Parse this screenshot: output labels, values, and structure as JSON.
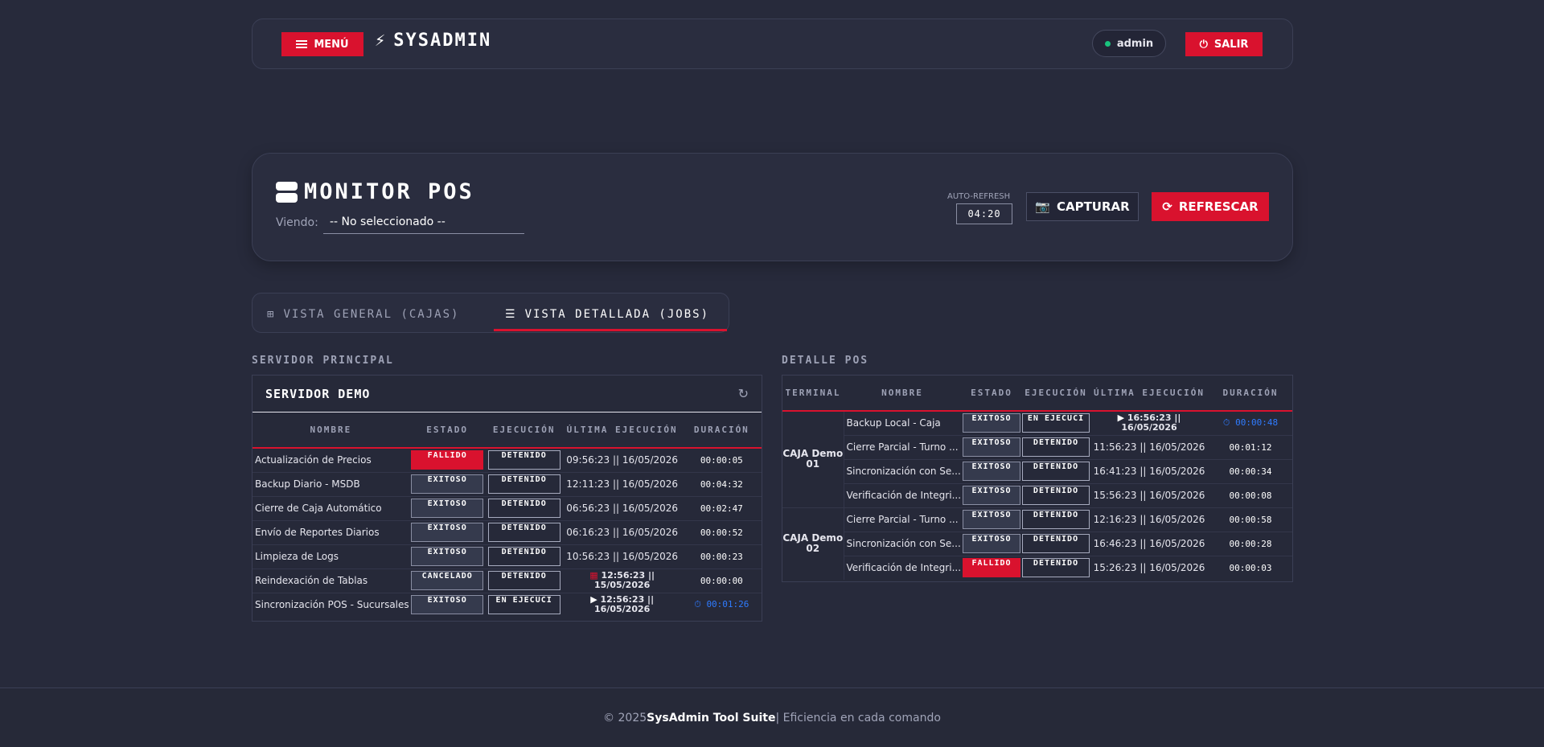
{
  "header": {
    "menu_label": "MENÚ",
    "brand": "SYSADMIN",
    "user": "admin",
    "logout_label": "SALIR",
    "colors": {
      "accent": "#d9122e",
      "online": "#19c37d"
    }
  },
  "monitor": {
    "title": "MONITOR POS",
    "viendo_label": "Viendo:",
    "viendo_value": "-- No seleccionado --",
    "auto_refresh_label": "AUTO-REFRESH",
    "auto_refresh_value": "04:20",
    "capture_label": "CAPTURAR",
    "refresh_label": "REFRESCAR"
  },
  "tabs": [
    {
      "label": "VISTA GENERAL (CAJAS)",
      "icon": "grid-icon",
      "active": false
    },
    {
      "label": "VISTA DETALLADA (JOBS)",
      "icon": "list-check-icon",
      "active": true
    }
  ],
  "servidor": {
    "section_title": "SERVIDOR PRINCIPAL",
    "card_title": "SERVIDOR DEMO",
    "columns": [
      "NOMBRE",
      "ESTADO",
      "EJECUCIÓN",
      "ÚLTIMA EJECUCIÓN",
      "DURACIÓN"
    ],
    "rows": [
      {
        "nombre": "Actualización de Precios",
        "estado": "FALLIDO",
        "ejecucion": "DETENIDO",
        "ultima": "09:56:23 || 16/05/2026",
        "duracion": "00:00:05"
      },
      {
        "nombre": "Backup Diario - MSDB",
        "estado": "EXITOSO",
        "ejecucion": "DETENIDO",
        "ultima": "12:11:23 || 16/05/2026",
        "duracion": "00:04:32"
      },
      {
        "nombre": "Cierre de Caja Automático",
        "estado": "EXITOSO",
        "ejecucion": "DETENIDO",
        "ultima": "06:56:23 || 16/05/2026",
        "duracion": "00:02:47"
      },
      {
        "nombre": "Envío de Reportes Diarios",
        "estado": "EXITOSO",
        "ejecucion": "DETENIDO",
        "ultima": "06:16:23 || 16/05/2026",
        "duracion": "00:00:52"
      },
      {
        "nombre": "Limpieza de Logs",
        "estado": "EXITOSO",
        "ejecucion": "DETENIDO",
        "ultima": "10:56:23 || 16/05/2026",
        "duracion": "00:00:23"
      },
      {
        "nombre": "Reindexación de Tablas",
        "estado": "CANCELADO",
        "ejecucion": "DETENIDO",
        "ultima": "12:56:23 || 15/05/2026",
        "duracion": "00:00:00",
        "icon": "calendar-icon"
      },
      {
        "nombre": "Sincronización POS - Sucursales",
        "estado": "EXITOSO",
        "ejecucion": "EN EJECUCI",
        "ultima": "12:56:23 || 16/05/2026",
        "duracion": "00:01:26",
        "icon": "play-icon",
        "running": true
      }
    ]
  },
  "detalle": {
    "section_title": "DETALLE POS",
    "columns": [
      "TERMINAL",
      "NOMBRE",
      "ESTADO",
      "EJECUCIÓN",
      "ÚLTIMA EJECUCIÓN",
      "DURACIÓN"
    ],
    "groups": [
      {
        "terminal": "CAJA Demo 01",
        "rows": [
          {
            "nombre": "Backup Local - Caja",
            "estado": "EXITOSO",
            "ejecucion": "EN EJECUCI",
            "ultima": "16:56:23 || 16/05/2026",
            "duracion": "00:00:48",
            "icon": "play-icon",
            "running": true
          },
          {
            "nombre": "Cierre Parcial - Turno ...",
            "estado": "EXITOSO",
            "ejecucion": "DETENIDO",
            "ultima": "11:56:23 || 16/05/2026",
            "duracion": "00:01:12"
          },
          {
            "nombre": "Sincronización con Se...",
            "estado": "EXITOSO",
            "ejecucion": "DETENIDO",
            "ultima": "16:41:23 || 16/05/2026",
            "duracion": "00:00:34"
          },
          {
            "nombre": "Verificación de Integri...",
            "estado": "EXITOSO",
            "ejecucion": "DETENIDO",
            "ultima": "15:56:23 || 16/05/2026",
            "duracion": "00:00:08"
          }
        ]
      },
      {
        "terminal": "CAJA Demo 02",
        "rows": [
          {
            "nombre": "Cierre Parcial - Turno ...",
            "estado": "EXITOSO",
            "ejecucion": "DETENIDO",
            "ultima": "12:16:23 || 16/05/2026",
            "duracion": "00:00:58"
          },
          {
            "nombre": "Sincronización con Se...",
            "estado": "EXITOSO",
            "ejecucion": "DETENIDO",
            "ultima": "16:46:23 || 16/05/2026",
            "duracion": "00:00:28"
          },
          {
            "nombre": "Verificación de Integri...",
            "estado": "FALLIDO",
            "ejecucion": "DETENIDO",
            "ultima": "15:26:23 || 16/05/2026",
            "duracion": "00:00:03"
          }
        ]
      }
    ]
  },
  "footer": {
    "copy": "© 2025 ",
    "brand": "SysAdmin Tool Suite",
    "tagline": " | Eficiencia en cada comando"
  }
}
